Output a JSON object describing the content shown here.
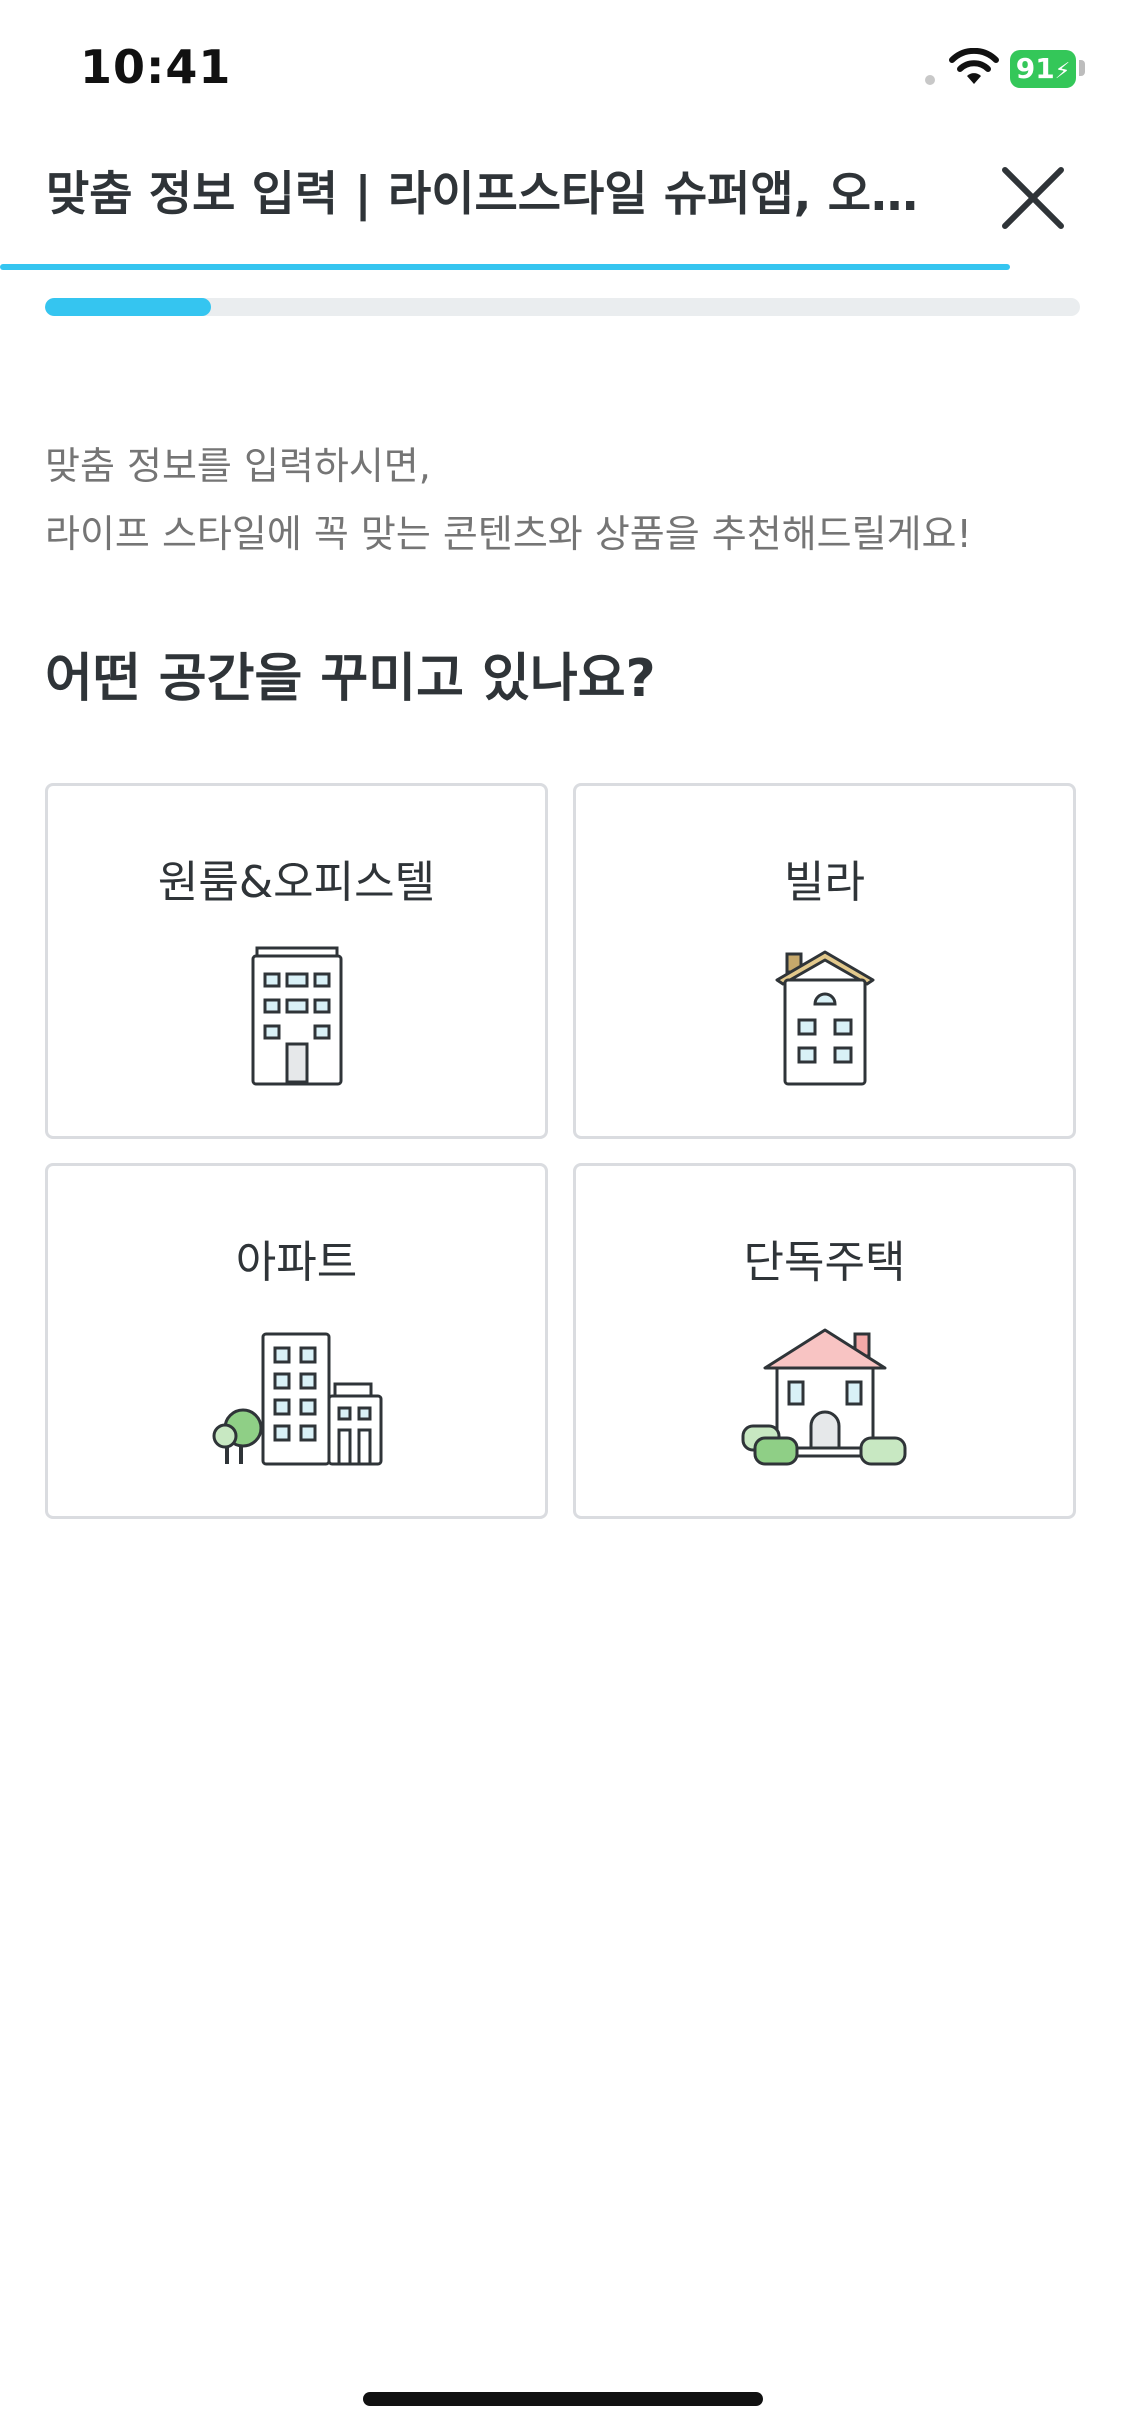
{
  "status_bar": {
    "time": "10:41",
    "battery": "91",
    "wifi_icon": "wifi-icon",
    "battery_color": "#34c759"
  },
  "header": {
    "title": "맞춤 정보 입력 | 라이프스타일 슈퍼앱, 오늘의집",
    "close_icon": "close-icon",
    "accent_color": "#35c5f0"
  },
  "progress": {
    "fraction": 0.16
  },
  "intro": {
    "line1": "맞춤 정보를 입력하시면,",
    "line2": "라이프 스타일에 꼭 맞는 콘텐츠와 상품을 추천해드릴게요!"
  },
  "question": "어떤 공간을 꾸미고 있나요?",
  "options": [
    {
      "label": "원룸&오피스텔",
      "icon": "officetel-building-icon"
    },
    {
      "label": "빌라",
      "icon": "villa-house-icon"
    },
    {
      "label": "아파트",
      "icon": "apartment-building-icon"
    },
    {
      "label": "단독주택",
      "icon": "detached-house-icon"
    }
  ]
}
